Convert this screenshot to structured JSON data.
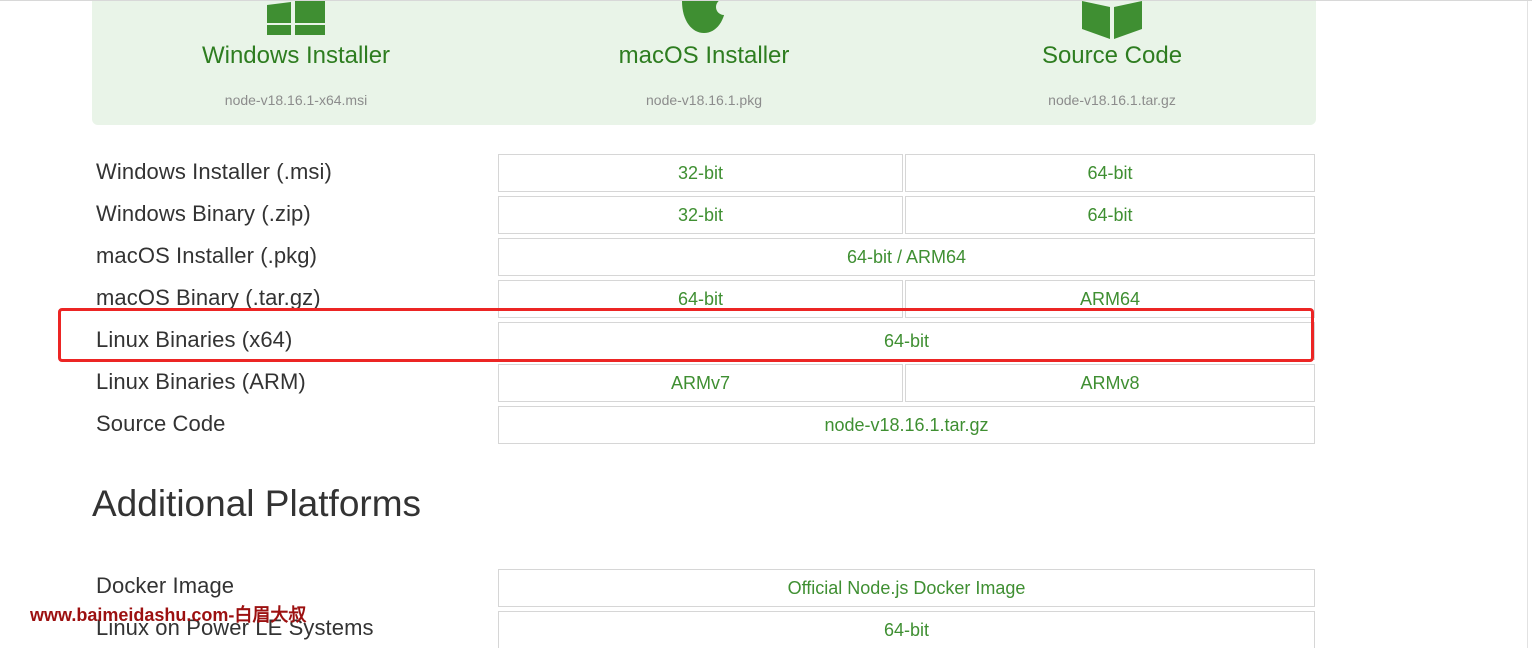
{
  "hero": {
    "windows": {
      "title": "Windows Installer",
      "file": "node-v18.16.1-x64.msi",
      "icon": "windows-icon"
    },
    "macos": {
      "title": "macOS Installer",
      "file": "node-v18.16.1.pkg",
      "icon": "apple-icon"
    },
    "source": {
      "title": "Source Code",
      "file": "node-v18.16.1.tar.gz",
      "icon": "box-icon"
    }
  },
  "downloads": {
    "windows_installer": {
      "label": "Windows Installer (.msi)",
      "links": [
        "32-bit",
        "64-bit"
      ]
    },
    "windows_binary": {
      "label": "Windows Binary (.zip)",
      "links": [
        "32-bit",
        "64-bit"
      ]
    },
    "macos_installer": {
      "label": "macOS Installer (.pkg)",
      "links": [
        "64-bit / ARM64"
      ]
    },
    "macos_binary": {
      "label": "macOS Binary (.tar.gz)",
      "links": [
        "64-bit",
        "ARM64"
      ]
    },
    "linux_x64": {
      "label": "Linux Binaries (x64)",
      "links": [
        "64-bit"
      ]
    },
    "linux_arm": {
      "label": "Linux Binaries (ARM)",
      "links": [
        "ARMv7",
        "ARMv8"
      ]
    },
    "source_code": {
      "label": "Source Code",
      "links": [
        "node-v18.16.1.tar.gz"
      ]
    }
  },
  "additional": {
    "title": "Additional Platforms",
    "docker": {
      "label": "Docker Image",
      "links": [
        "Official Node.js Docker Image"
      ]
    },
    "power_le": {
      "label": "Linux on Power LE Systems",
      "links": [
        "64-bit"
      ]
    }
  },
  "watermark": "www.baimeidashu.com-白眉大叔",
  "colors": {
    "accent": "#3f8f32",
    "hero_bg": "#e9f4e8",
    "hero_title": "#2e7d20",
    "highlight": "#ec2524",
    "watermark": "#9c1010"
  }
}
